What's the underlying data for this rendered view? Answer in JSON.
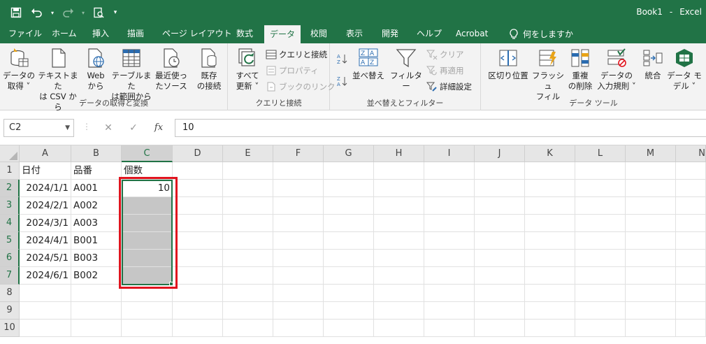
{
  "titlebar": {
    "title": "Book1",
    "separator": "-",
    "app": "Excel",
    "qat_more": "▾"
  },
  "tabs": [
    {
      "label": "ファイル"
    },
    {
      "label": "ホーム"
    },
    {
      "label": "挿入"
    },
    {
      "label": "描画"
    },
    {
      "label": "ページ レイアウト"
    },
    {
      "label": "数式"
    },
    {
      "label": "データ",
      "active": true
    },
    {
      "label": "校閲"
    },
    {
      "label": "表示"
    },
    {
      "label": "開発"
    },
    {
      "label": "ヘルプ"
    },
    {
      "label": "Acrobat"
    }
  ],
  "tell_me": {
    "label": "何をしますか"
  },
  "ribbon": {
    "group_get_data": {
      "label": "データの取得と変換",
      "get_data": "データの\n取得 ˅",
      "from_text_csv": "テキストまた\nは CSV から",
      "from_web": "Web\nから",
      "from_table": "テーブルまた\nは範囲から",
      "recent_sources": "最近使っ\nたソース",
      "existing_connections": "既存\nの接続"
    },
    "group_queries": {
      "label": "クエリと接続",
      "refresh_all": "すべて\n更新 ˅",
      "queries_connections": "クエリと接続",
      "properties": "プロパティ",
      "edit_links": "ブックのリンク"
    },
    "group_sort_filter": {
      "label": "並べ替えとフィルター",
      "sort": "並べ替え",
      "filter": "フィルター",
      "clear": "クリア",
      "reapply": "再適用",
      "advanced": "詳細設定"
    },
    "group_data_tools": {
      "label": "データ ツール",
      "text_to_columns": "区切り位置",
      "flash_fill": "フラッシュ\nフィル",
      "remove_duplicates": "重複\nの削除",
      "data_validation": "データの\n入力規則 ˅",
      "consolidate": "統合",
      "data_model": "データ モ\nデル ˅"
    }
  },
  "formula_bar": {
    "name_box": "C2",
    "formula": "10",
    "cancel": "✕",
    "enter": "✓",
    "fx": "fx"
  },
  "sheet": {
    "columns": [
      "A",
      "B",
      "C",
      "D",
      "E",
      "F",
      "G",
      "H",
      "I",
      "J",
      "K",
      "L",
      "M",
      "N"
    ],
    "rows": [
      "1",
      "2",
      "3",
      "4",
      "5",
      "6",
      "7",
      "8",
      "9",
      "10"
    ],
    "data": [
      [
        "日付",
        "品番",
        "個数"
      ],
      [
        "2024/1/1",
        "A001",
        "10"
      ],
      [
        "2024/2/1",
        "A002",
        ""
      ],
      [
        "2024/3/1",
        "A003",
        ""
      ],
      [
        "2024/4/1",
        "B001",
        ""
      ],
      [
        "2024/5/1",
        "B003",
        ""
      ],
      [
        "2024/6/1",
        "B002",
        ""
      ]
    ]
  },
  "colors": {
    "excel_green": "#217346",
    "highlight_red": "#e0141e",
    "selection_fill": "#c6c6c6"
  }
}
